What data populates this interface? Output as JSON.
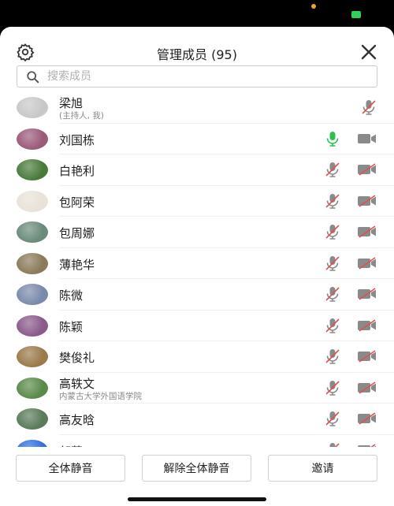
{
  "header": {
    "title": "管理成员 (95)",
    "settings_icon": "gear-icon",
    "close_icon": "close-icon"
  },
  "search": {
    "placeholder": "搜索成员",
    "value": ""
  },
  "members": [
    {
      "name": "梁旭",
      "subtitle": "(主持人, 我)",
      "mic": "none",
      "camera": "off",
      "avatar_color": "#c8c8c8"
    },
    {
      "name": "刘国栋",
      "subtitle": "",
      "mic": "on",
      "camera": "on",
      "avatar_color": "#9a5a7a"
    },
    {
      "name": "白艳利",
      "subtitle": "",
      "mic": "off",
      "camera": "off",
      "avatar_color": "#4a7a3a"
    },
    {
      "name": "包阿荣",
      "subtitle": "",
      "mic": "off",
      "camera": "off",
      "avatar_color": "#e8e2d8"
    },
    {
      "name": "包周娜",
      "subtitle": "",
      "mic": "off",
      "camera": "off",
      "avatar_color": "#6a8a7a"
    },
    {
      "name": "薄艳华",
      "subtitle": "",
      "mic": "off",
      "camera": "off",
      "avatar_color": "#8a7a5a"
    },
    {
      "name": "陈微",
      "subtitle": "",
      "mic": "off",
      "camera": "off",
      "avatar_color": "#7a8aaa"
    },
    {
      "name": "陈颖",
      "subtitle": "",
      "mic": "off",
      "camera": "off",
      "avatar_color": "#8a5a8a"
    },
    {
      "name": "樊俊礼",
      "subtitle": "",
      "mic": "off",
      "camera": "off",
      "avatar_color": "#9a7a4a"
    },
    {
      "name": "高轶文",
      "subtitle": "内蒙古大学外国语学院",
      "mic": "off",
      "camera": "off",
      "avatar_color": "#5a8a4a"
    },
    {
      "name": "高友晗",
      "subtitle": "",
      "mic": "off",
      "camera": "off",
      "avatar_color": "#5a7a5a"
    },
    {
      "name": "郭蓉",
      "subtitle": "",
      "mic": "off",
      "camera": "off",
      "avatar_color": "#2f6fe0"
    }
  ],
  "footer": {
    "mute_all": "全体静音",
    "unmute_all": "解除全体静音",
    "invite": "邀请"
  },
  "colors": {
    "mic_on": "#2fbf4f",
    "icon_gray": "#8a8a8a",
    "muted_slash": "#e05050"
  }
}
